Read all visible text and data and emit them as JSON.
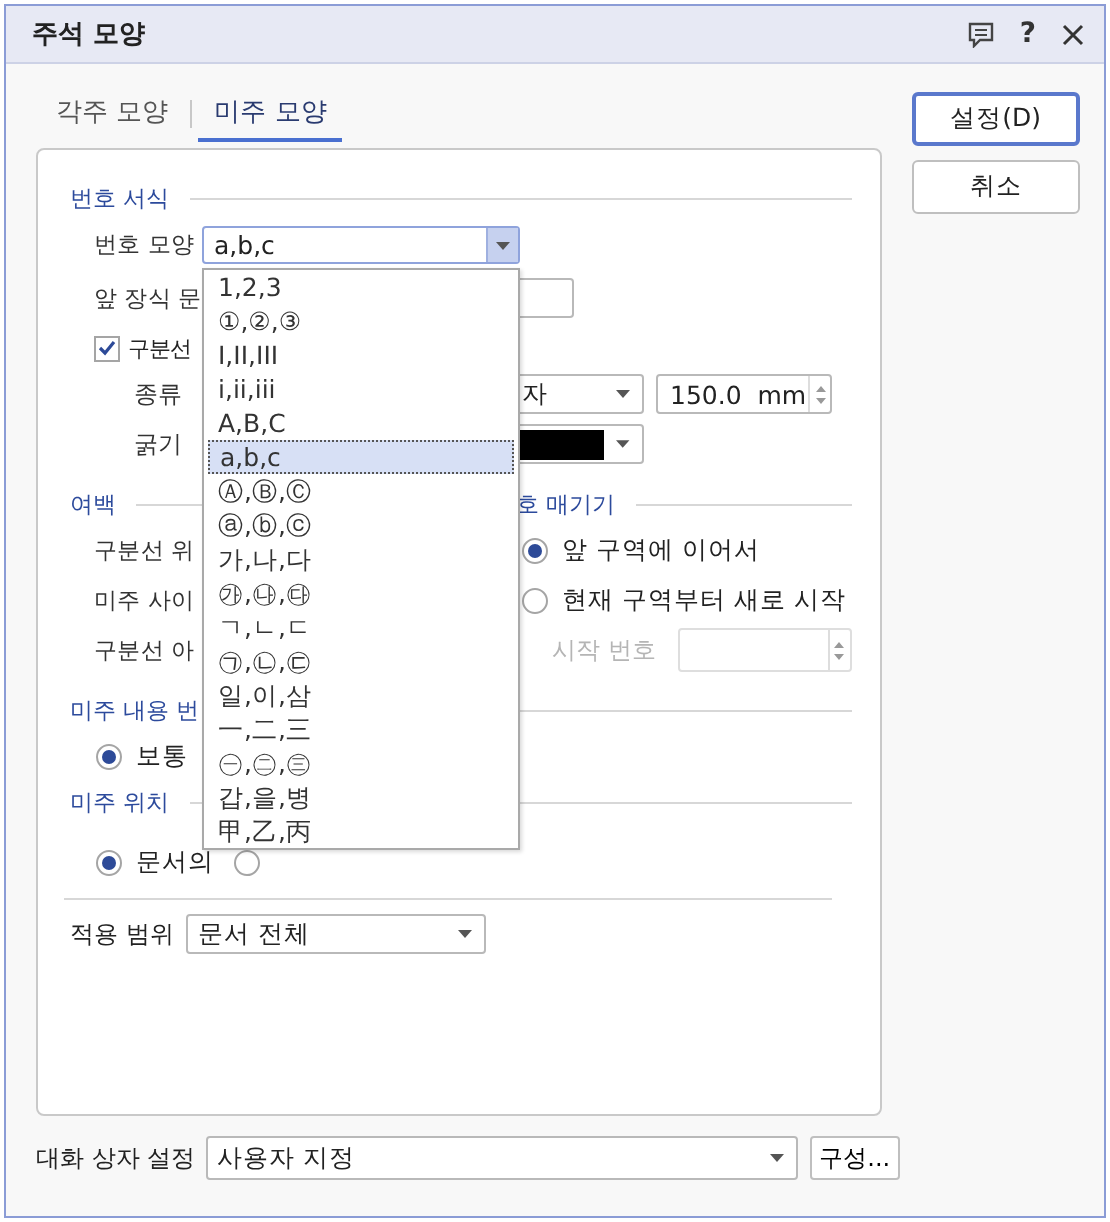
{
  "window": {
    "title": "주석 모양",
    "help": "?"
  },
  "tabs": [
    {
      "label": "각주 모양",
      "selected": false
    },
    {
      "label": "미주 모양",
      "selected": true
    }
  ],
  "buttons": [
    {
      "label": "설정(D)",
      "default": true
    },
    {
      "label": "취소",
      "default": false
    }
  ],
  "number_format": {
    "title": "번호 서식",
    "shape": {
      "label": "번호 모양",
      "value": "a,b,c",
      "expanded": true,
      "options": [
        {
          "label": "1,2,3",
          "selected": false
        },
        {
          "label": "①,②,③",
          "selected": false
        },
        {
          "label": "I,II,III",
          "selected": false
        },
        {
          "label": "i,ii,iii",
          "selected": false
        },
        {
          "label": "A,B,C",
          "selected": false
        },
        {
          "label": "a,b,c",
          "selected": true
        },
        {
          "label": "Ⓐ,Ⓑ,Ⓒ",
          "selected": false
        },
        {
          "label": "ⓐ,ⓑ,ⓒ",
          "selected": false
        },
        {
          "label": "가,나,다",
          "selected": false
        },
        {
          "label": "㉮,㉯,㉰",
          "selected": false
        },
        {
          "label": "ㄱ,ㄴ,ㄷ",
          "selected": false
        },
        {
          "label": "㉠,㉡,㉢",
          "selected": false
        },
        {
          "label": "일,이,삼",
          "selected": false
        },
        {
          "label": "一,二,三",
          "selected": false
        },
        {
          "label": "㊀,㊁,㊂",
          "selected": false
        },
        {
          "label": "갑,을,병",
          "selected": false
        },
        {
          "label": "甲,乙,丙",
          "selected": false
        }
      ]
    },
    "prefix": {
      "label": "앞 장식 문"
    },
    "separator": {
      "label": "구분선",
      "checked": true
    },
    "line_type": {
      "label": "종류",
      "value": "자",
      "length": "150.0",
      "unit": "mm"
    },
    "thickness": {
      "label": "굵기"
    }
  },
  "margins": {
    "title": "여백",
    "labels": [
      "구분선 위",
      "미주 사이",
      "구분선 아"
    ]
  },
  "numbering": {
    "title": "호 매기기",
    "options": [
      {
        "label": "앞 구역에 이어서",
        "selected": true
      },
      {
        "label": "현재 구역부터 새로 시작",
        "selected": false
      }
    ],
    "start_number": {
      "label": "시작 번호",
      "disabled": true
    }
  },
  "content_number": {
    "title": "미주 내용 번",
    "options": [
      {
        "label": "보통",
        "selected": true
      }
    ]
  },
  "position": {
    "title": "미주 위치",
    "options": [
      {
        "label": "문서의",
        "selected": true
      },
      {
        "selected": false
      }
    ]
  },
  "scope": {
    "label": "적용 범위",
    "value": "문서 전체"
  },
  "footer": {
    "label": "대화 상자 설정",
    "value": "사용자 지정",
    "button": "구성..."
  }
}
